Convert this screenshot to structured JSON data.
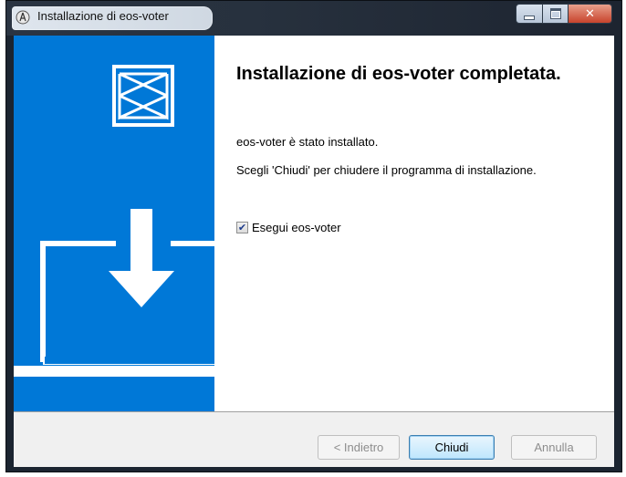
{
  "window": {
    "title": "Installazione di eos-voter"
  },
  "content": {
    "heading": "Installazione di eos-voter completata.",
    "installed_text": "eos-voter è stato installato.",
    "instructions": "Scegli 'Chiudi' per chiudere il programma di installazione.",
    "run_checkbox": {
      "label": "Esegui eos-voter",
      "checked": true
    }
  },
  "buttons": {
    "back_label": "< Indietro",
    "finish_label": "Chiudi",
    "cancel_label": "Annulla"
  },
  "colors": {
    "banner": "#0078d7",
    "footer": "#f0f0f0"
  },
  "icons": {
    "title": "installer-icon",
    "logo": "eos-voter-logo",
    "banner": "download-to-laptop-illustration"
  }
}
